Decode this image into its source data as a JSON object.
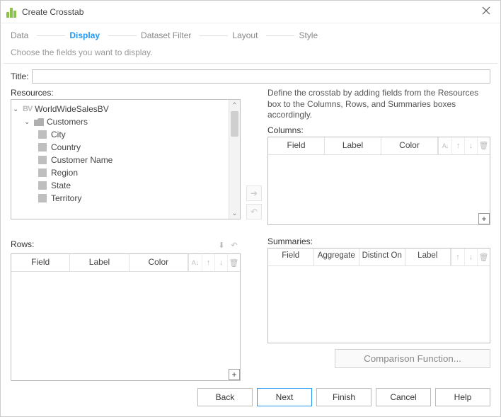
{
  "window": {
    "title": "Create Crosstab"
  },
  "stepper": {
    "steps": [
      "Data",
      "Display",
      "Dataset Filter",
      "Layout",
      "Style"
    ],
    "active_index": 1
  },
  "description": "Choose the fields you want to display.",
  "title_field": {
    "label": "Title:",
    "value": ""
  },
  "resources": {
    "label": "Resources:",
    "tree": {
      "root": {
        "name": "WorldWideSalesBV",
        "expanded": true
      },
      "group": {
        "name": "Customers",
        "expanded": true
      },
      "fields": [
        "City",
        "Country",
        "Customer Name",
        "Region",
        "State",
        "Territory"
      ]
    }
  },
  "helper_text": "Define the crosstab by adding fields from the Resources box to the Columns, Rows, and Summaries boxes accordingly.",
  "columns_panel": {
    "label": "Columns:",
    "headers": [
      "Field",
      "Label",
      "Color"
    ]
  },
  "rows_panel": {
    "label": "Rows:",
    "headers": [
      "Field",
      "Label",
      "Color"
    ]
  },
  "summaries_panel": {
    "label": "Summaries:",
    "headers": [
      "Field",
      "Aggregate",
      "Distinct On",
      "Label"
    ]
  },
  "comparison_button": "Comparison Function...",
  "footer": {
    "back": "Back",
    "next": "Next",
    "finish": "Finish",
    "cancel": "Cancel",
    "help": "Help"
  },
  "icons": {
    "sort": "A↓Z",
    "up": "↑",
    "down": "↓",
    "delete": "🗑",
    "move_right": "➜",
    "move_left": "⟲",
    "plus": "+"
  }
}
